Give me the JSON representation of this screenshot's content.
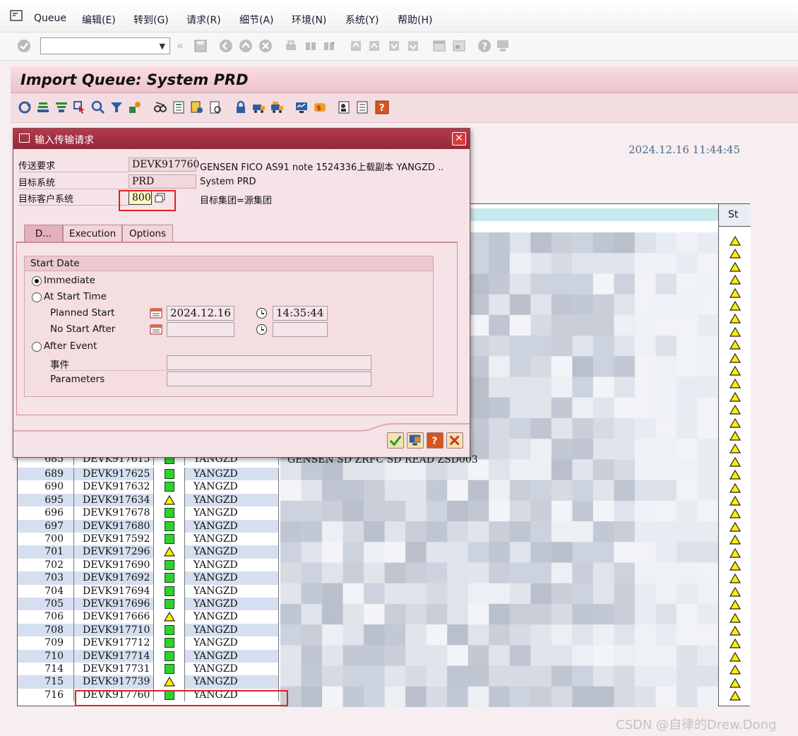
{
  "menubar": {
    "items": [
      "Queue",
      "编辑(E)",
      "转到(G)",
      "请求(R)",
      "细节(A)",
      "环境(N)",
      "系统(Y)",
      "帮助(H)"
    ]
  },
  "title": "Import Queue: System PRD",
  "timestamp": "2024.12.16  11:44:45",
  "table": {
    "st_header": "St",
    "partial_row": {
      "num": "685",
      "request": "DEVK917615",
      "owner": "YANGZD",
      "text": "GENSEN SD ZRFC SD READ ZSD003"
    },
    "rows": [
      {
        "num": "689",
        "request": "DEVK917625",
        "status": "ok",
        "owner": "YANGZD"
      },
      {
        "num": "690",
        "request": "DEVK917632",
        "status": "ok",
        "owner": "YANGZD"
      },
      {
        "num": "695",
        "request": "DEVK917634",
        "status": "warn",
        "owner": "YANGZD"
      },
      {
        "num": "696",
        "request": "DEVK917678",
        "status": "ok",
        "owner": "YANGZD"
      },
      {
        "num": "697",
        "request": "DEVK917680",
        "status": "ok",
        "owner": "YANGZD"
      },
      {
        "num": "700",
        "request": "DEVK917592",
        "status": "ok",
        "owner": "YANGZD"
      },
      {
        "num": "701",
        "request": "DEVK917296",
        "status": "warn",
        "owner": "YANGZD"
      },
      {
        "num": "702",
        "request": "DEVK917690",
        "status": "ok",
        "owner": "YANGZD"
      },
      {
        "num": "703",
        "request": "DEVK917692",
        "status": "ok",
        "owner": "YANGZD"
      },
      {
        "num": "704",
        "request": "DEVK917694",
        "status": "ok",
        "owner": "YANGZD"
      },
      {
        "num": "705",
        "request": "DEVK917696",
        "status": "ok",
        "owner": "YANGZD"
      },
      {
        "num": "706",
        "request": "DEVK917666",
        "status": "warn",
        "owner": "YANGZD"
      },
      {
        "num": "708",
        "request": "DEVK917710",
        "status": "ok",
        "owner": "YANGZD"
      },
      {
        "num": "709",
        "request": "DEVK917712",
        "status": "ok",
        "owner": "YANGZD"
      },
      {
        "num": "710",
        "request": "DEVK917714",
        "status": "ok",
        "owner": "YANGZD"
      },
      {
        "num": "714",
        "request": "DEVK917731",
        "status": "ok",
        "owner": "YANGZD"
      },
      {
        "num": "715",
        "request": "DEVK917739",
        "status": "warn",
        "owner": "YANGZD"
      },
      {
        "num": "716",
        "request": "DEVK917760",
        "status": "ok",
        "owner": "YANGZD"
      }
    ]
  },
  "dialog": {
    "title": "输入传输请求",
    "labels": {
      "request": "传送要求",
      "target_system": "目标系统",
      "target_client": "目标客户系统"
    },
    "request_value": "DEVK917760",
    "request_desc": "GENSEN FICO AS91 note 1524336上载副本 YANGZD ..",
    "target_system_value": "PRD",
    "target_system_desc": "System PRD",
    "target_client_value": "800",
    "target_client_desc": "目标集团=源集团",
    "tabs": [
      "D...",
      "Execution",
      "Options"
    ],
    "group_title": "Start Date",
    "options": {
      "immediate": "Immediate",
      "at_start_time": "At Start Time",
      "planned_start": "Planned Start",
      "no_start_after": "No Start After",
      "after_event": "After Event",
      "event": "事件",
      "parameters": "Parameters"
    },
    "planned_date": "2024.12.16",
    "planned_time": "14:35:44",
    "selected_option": "immediate"
  },
  "watermark": "CSDN @自律的Drew.Dong"
}
